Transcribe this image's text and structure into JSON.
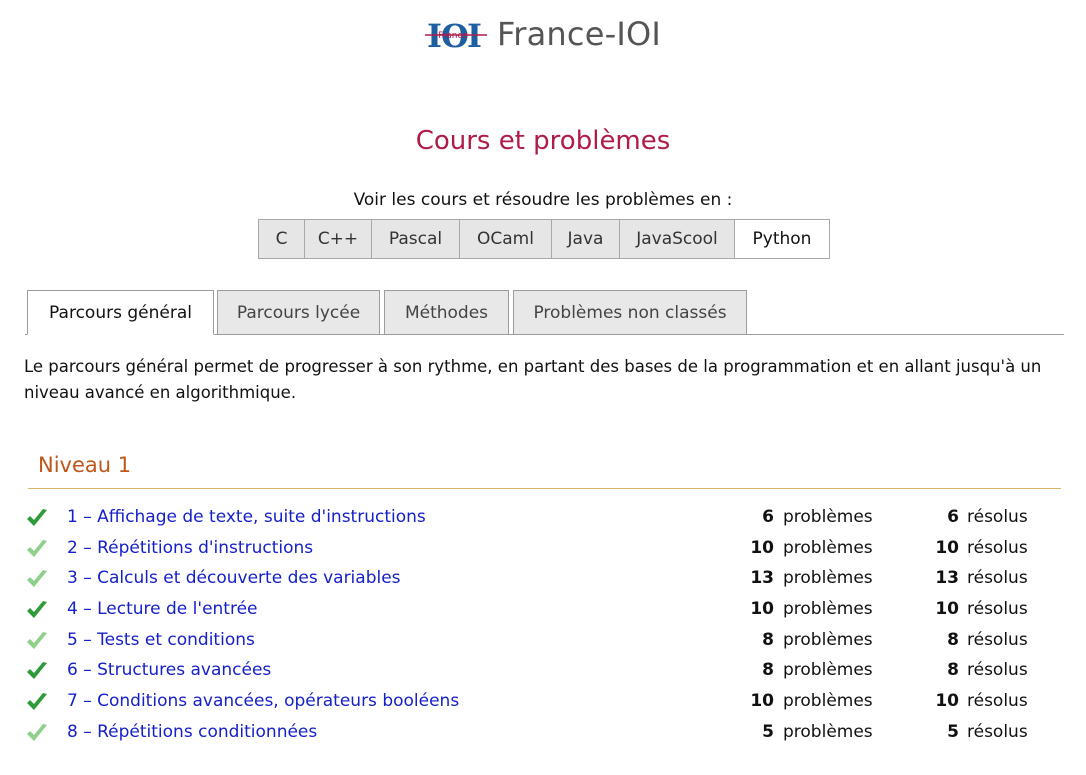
{
  "site": {
    "logo_text": "IOI",
    "logo_subtext": "France",
    "name": "France-IOI"
  },
  "page_title": "Cours et problèmes",
  "languages": {
    "prompt": "Voir les cours et résoudre les problèmes en :",
    "items": [
      {
        "label": "C",
        "active": false
      },
      {
        "label": "C++",
        "active": false
      },
      {
        "label": "Pascal",
        "active": false
      },
      {
        "label": "OCaml",
        "active": false
      },
      {
        "label": "Java",
        "active": false
      },
      {
        "label": "JavaScool",
        "active": false
      },
      {
        "label": "Python",
        "active": true
      }
    ]
  },
  "tabs": [
    {
      "label": "Parcours général",
      "active": true
    },
    {
      "label": "Parcours lycée",
      "active": false
    },
    {
      "label": "Méthodes",
      "active": false
    },
    {
      "label": "Problèmes non classés",
      "active": false
    }
  ],
  "intro": "Le parcours général permet de progresser à son rythme, en partant des bases de la programmation et en allant jusqu'à un niveau avancé en algorithmique.",
  "level": {
    "title": "Niveau 1",
    "problems_label": "problèmes",
    "solved_label": "résolus",
    "chapters": [
      {
        "title": "1 – Affichage de texte, suite d'instructions",
        "problems": "6",
        "solved": "6",
        "check": "dark"
      },
      {
        "title": "2 – Répétitions d'instructions",
        "problems": "10",
        "solved": "10",
        "check": "light"
      },
      {
        "title": "3 – Calculs et découverte des variables",
        "problems": "13",
        "solved": "13",
        "check": "light"
      },
      {
        "title": "4 – Lecture de l'entrée",
        "problems": "10",
        "solved": "10",
        "check": "dark"
      },
      {
        "title": "5 – Tests et conditions",
        "problems": "8",
        "solved": "8",
        "check": "light"
      },
      {
        "title": "6 – Structures avancées",
        "problems": "8",
        "solved": "8",
        "check": "dark"
      },
      {
        "title": "7 – Conditions avancées, opérateurs booléens",
        "problems": "10",
        "solved": "10",
        "check": "dark"
      },
      {
        "title": "8 – Répétitions conditionnées",
        "problems": "5",
        "solved": "5",
        "check": "light"
      }
    ]
  },
  "colors": {
    "title": "#b01c48",
    "level_title": "#c0571a",
    "link": "#1620c9",
    "check_dark": "#2e9b3a",
    "check_light": "#8fcf8a"
  },
  "icons": {
    "check": "checkmark-icon",
    "logo": "france-ioi-logo"
  }
}
